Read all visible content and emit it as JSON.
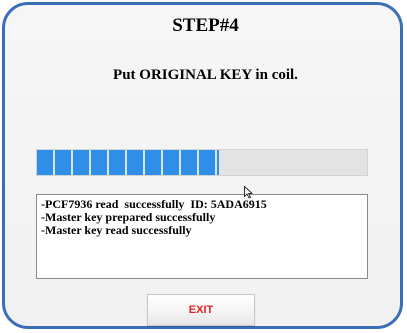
{
  "dialog": {
    "step_title": "STEP#4",
    "instruction": "Put ORIGINAL KEY in coil.",
    "progress": {
      "fraction": 0.55,
      "fill_color": "#2e8ee8"
    },
    "log_lines": [
      "-PCF7936 read  successfully  ID: 5ADA6915",
      "-Master key prepared successfully",
      "-Master key read successfully"
    ],
    "exit_label": "EXIT",
    "exit_color": "#e02020",
    "border_color": "#3a6fb8"
  },
  "icons": {
    "cursor": "mouse-pointer-icon"
  }
}
